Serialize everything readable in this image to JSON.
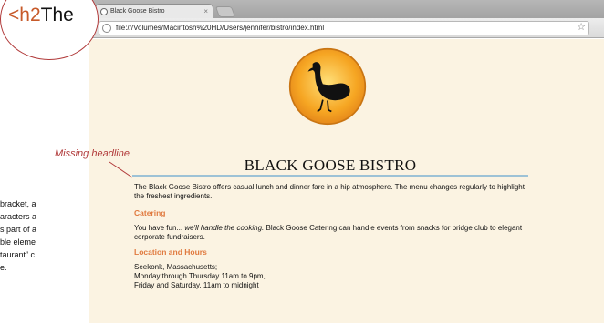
{
  "browser": {
    "tab_title": "Black Goose Bistro",
    "tab_close": "×",
    "url": "file:///Volumes/Macintosh%20HD/Users/jennifer/bistro/index.html",
    "star_glyph": "☆",
    "wrench_glyph": "🔧"
  },
  "callout": {
    "bubble_code": "<h2",
    "bubble_word": "The",
    "annotation": "Missing headline",
    "side_text": [
      "bracket, a",
      "aracters a",
      "s part of a",
      "ble eleme",
      "taurant” c",
      "e."
    ]
  },
  "page": {
    "title": "BLACK GOOSE BISTRO",
    "intro": "The Black Goose Bistro offers casual lunch and dinner fare in a hip atmosphere. The menu changes regularly to highlight the freshest ingredients.",
    "catering_heading": "Catering",
    "catering_lead": "You have fun...",
    "catering_emph": "we'll handle the cooking.",
    "catering_rest": "Black Goose Catering can handle events from snacks for bridge club to elegant corporate fundraisers.",
    "location_heading": "Location and Hours",
    "address_line": "Seekonk, Massachusetts;",
    "hours_1": "Monday through Thursday 11am to 9pm,",
    "hours_2": "Friday and Saturday, 11am to midnight"
  },
  "colors": {
    "heading_accent": "#e07a3f",
    "annotation_red": "#b13a3a",
    "page_bg": "#fbf3e2",
    "rule_blue": "#9dc2d6"
  }
}
